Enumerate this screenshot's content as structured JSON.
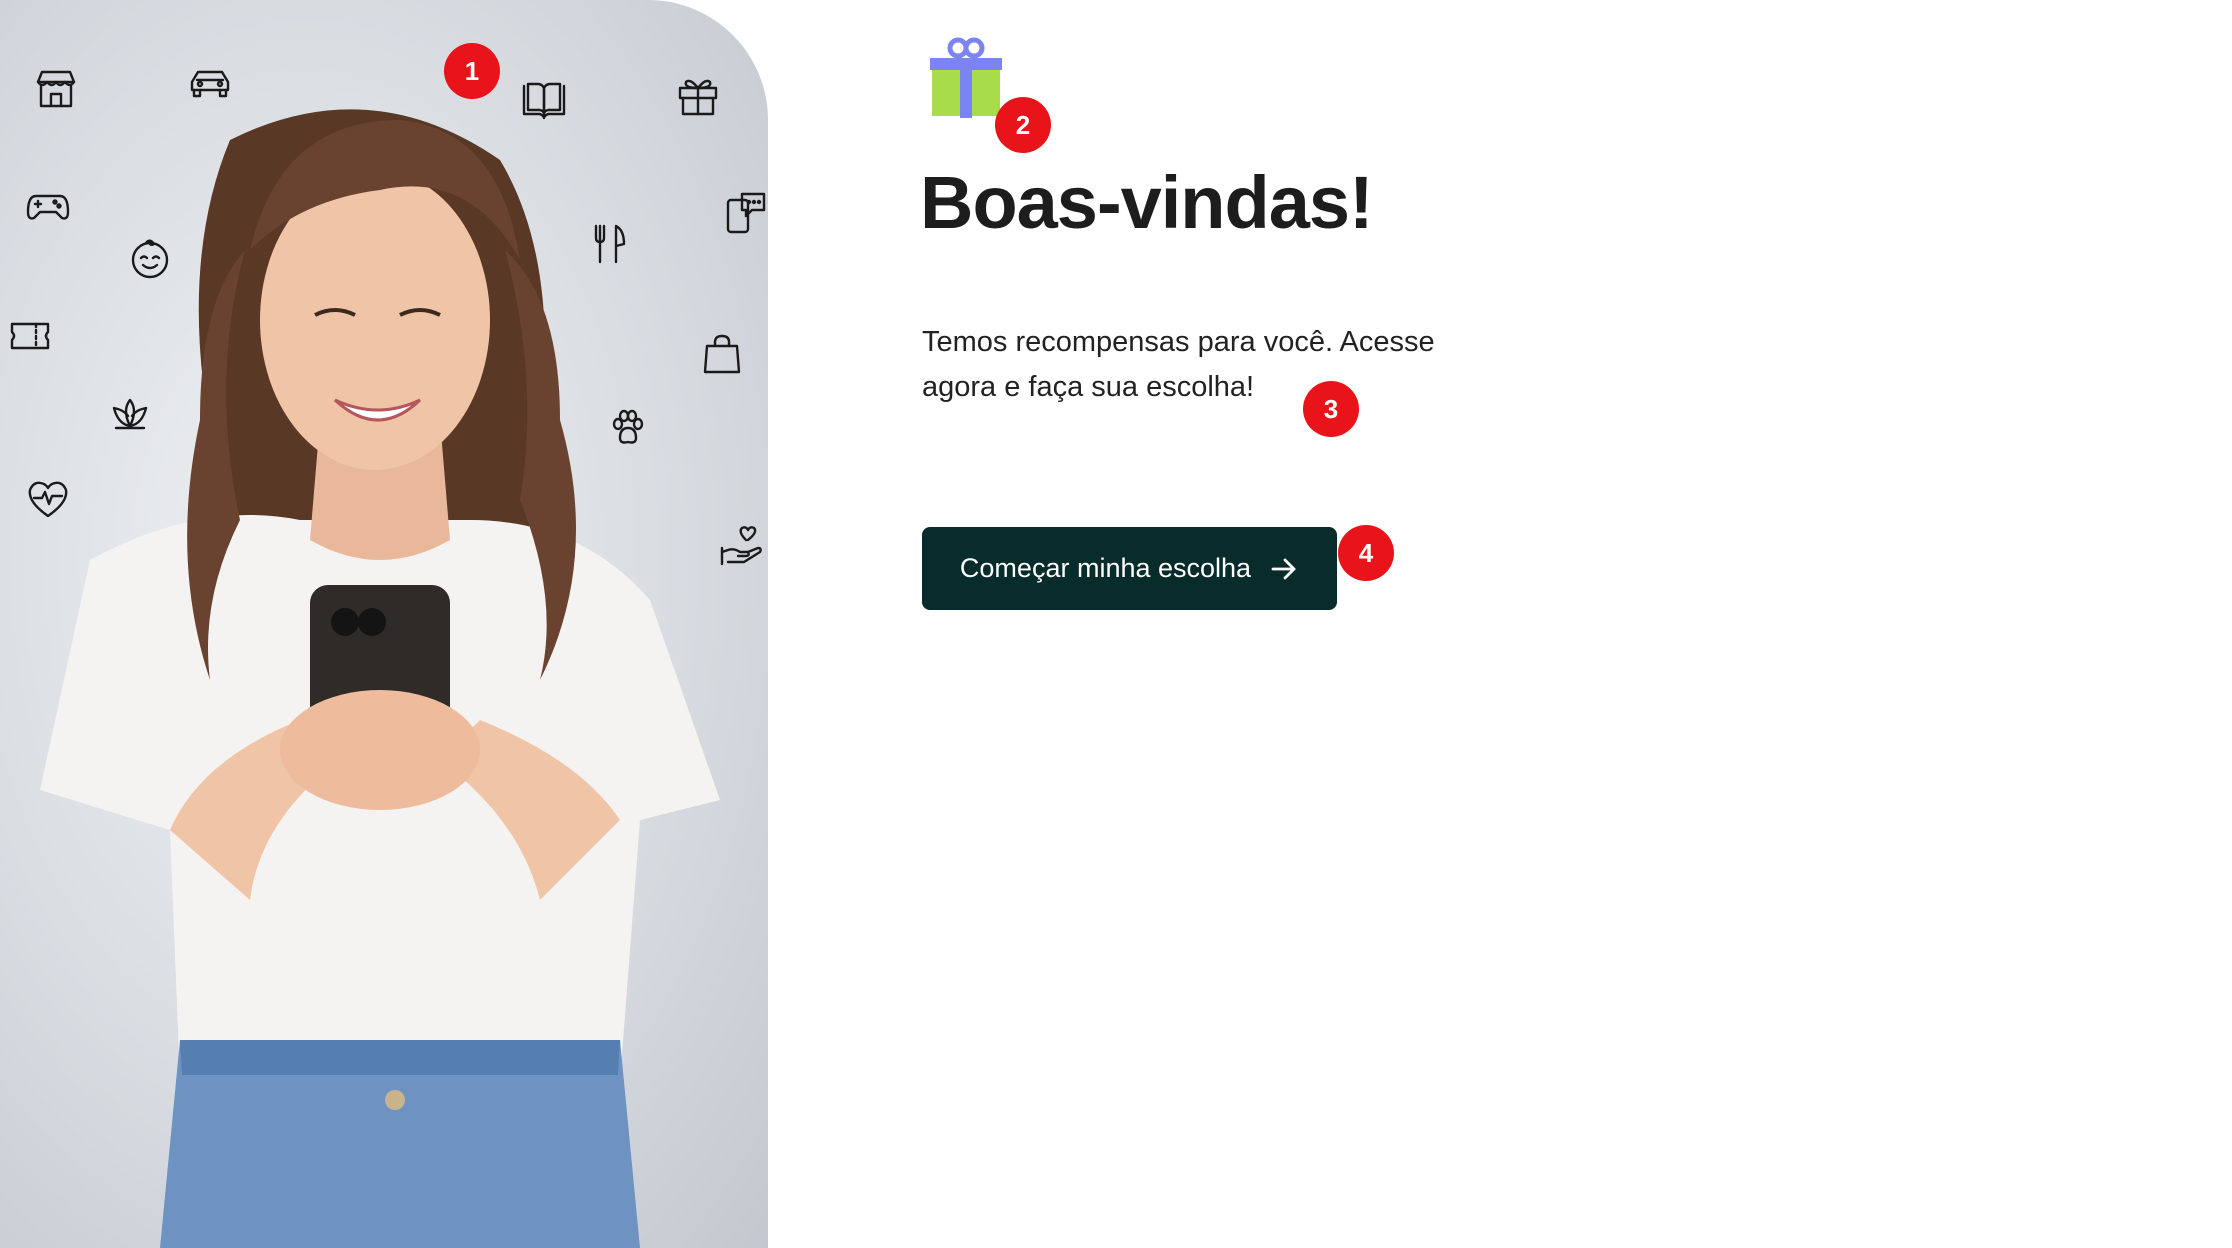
{
  "welcome": {
    "title": "Boas-vindas!",
    "subtitle": "Temos recompensas para você. Acesse agora e faça sua escolha!",
    "cta_label": "Começar minha escolha",
    "cta_icon": "arrow-right-icon",
    "brand_colors": {
      "cta_background": "#082b2b",
      "gift_box": "#a8dc4a",
      "gift_ribbon": "#7b84f0"
    }
  },
  "hero": {
    "icons": [
      "store-icon",
      "car-icon",
      "book-icon",
      "gift-icon",
      "gamepad-icon",
      "cutlery-icon",
      "chat-phone-icon",
      "baby-face-icon",
      "ticket-icon",
      "shopping-bag-icon",
      "lotus-icon",
      "paw-icon",
      "heart-pulse-icon",
      "hand-heart-icon"
    ]
  },
  "annotations": {
    "badges": [
      "1",
      "2",
      "3",
      "4"
    ],
    "badge_color": "#e8141a"
  }
}
